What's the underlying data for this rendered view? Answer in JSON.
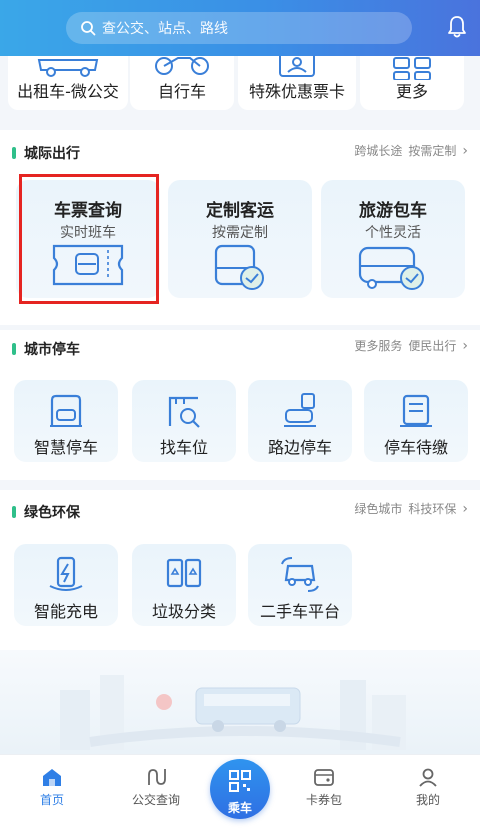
{
  "header": {
    "search_placeholder": "查公交、站点、路线"
  },
  "top_services": [
    {
      "label": "出租车-微公交",
      "icon": "car-icon"
    },
    {
      "label": "自行车",
      "icon": "bicycle-icon"
    },
    {
      "label": "特殊优惠票卡",
      "icon": "id-card-icon"
    },
    {
      "label": "更多",
      "icon": "grid-icon"
    }
  ],
  "intercity": {
    "title": "城际出行",
    "links": [
      "跨城长途",
      "按需定制"
    ],
    "cards": [
      {
        "title": "车票查询",
        "subtitle": "实时班车",
        "icon": "bus-ticket-icon",
        "highlighted": true
      },
      {
        "title": "定制客运",
        "subtitle": "按需定制",
        "icon": "bus-check-icon"
      },
      {
        "title": "旅游包车",
        "subtitle": "个性灵活",
        "icon": "coach-check-icon"
      }
    ]
  },
  "parking": {
    "title": "城市停车",
    "links": [
      "更多服务",
      "便民出行"
    ],
    "items": [
      {
        "label": "智慧停车",
        "icon": "smart-parking-icon"
      },
      {
        "label": "找车位",
        "icon": "find-spot-icon"
      },
      {
        "label": "路边停车",
        "icon": "roadside-parking-icon"
      },
      {
        "label": "停车待缴",
        "icon": "parking-bill-icon"
      }
    ]
  },
  "green": {
    "title": "绿色环保",
    "links": [
      "绿色城市",
      "科技环保"
    ],
    "items": [
      {
        "label": "智能充电",
        "icon": "charging-icon"
      },
      {
        "label": "垃圾分类",
        "icon": "recycle-bins-icon"
      },
      {
        "label": "二手车平台",
        "icon": "used-car-icon"
      }
    ]
  },
  "tabbar": {
    "home": "首页",
    "bus_query": "公交查询",
    "ride": "乘车",
    "wallet": "卡券包",
    "mine": "我的"
  },
  "colors": {
    "header_start": "#3aa7e8",
    "header_end": "#4a73dd",
    "accent": "#2f7fe6",
    "section_bar": "#2fbf8a",
    "highlight_box": "#e52421"
  }
}
